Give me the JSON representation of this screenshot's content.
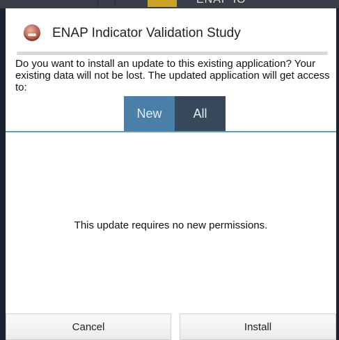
{
  "background": {
    "top_text": "ENAP IO"
  },
  "dialog": {
    "app_icon": "app-icon",
    "title": "ENAP Indicator Validation Study",
    "message": "Do you want to install an update to this existing application? Your existing data will not be lost. The updated application will get access to:",
    "tabs": [
      {
        "label": "New",
        "selected": true
      },
      {
        "label": "All",
        "selected": false
      }
    ],
    "permissions_text": "This update requires no new permissions.",
    "buttons": {
      "cancel_label": "Cancel",
      "install_label": "Install"
    }
  },
  "colors": {
    "tab_new": "#4a7fa7",
    "tab_all": "#36495b",
    "accent_line": "#5a9cc9"
  }
}
